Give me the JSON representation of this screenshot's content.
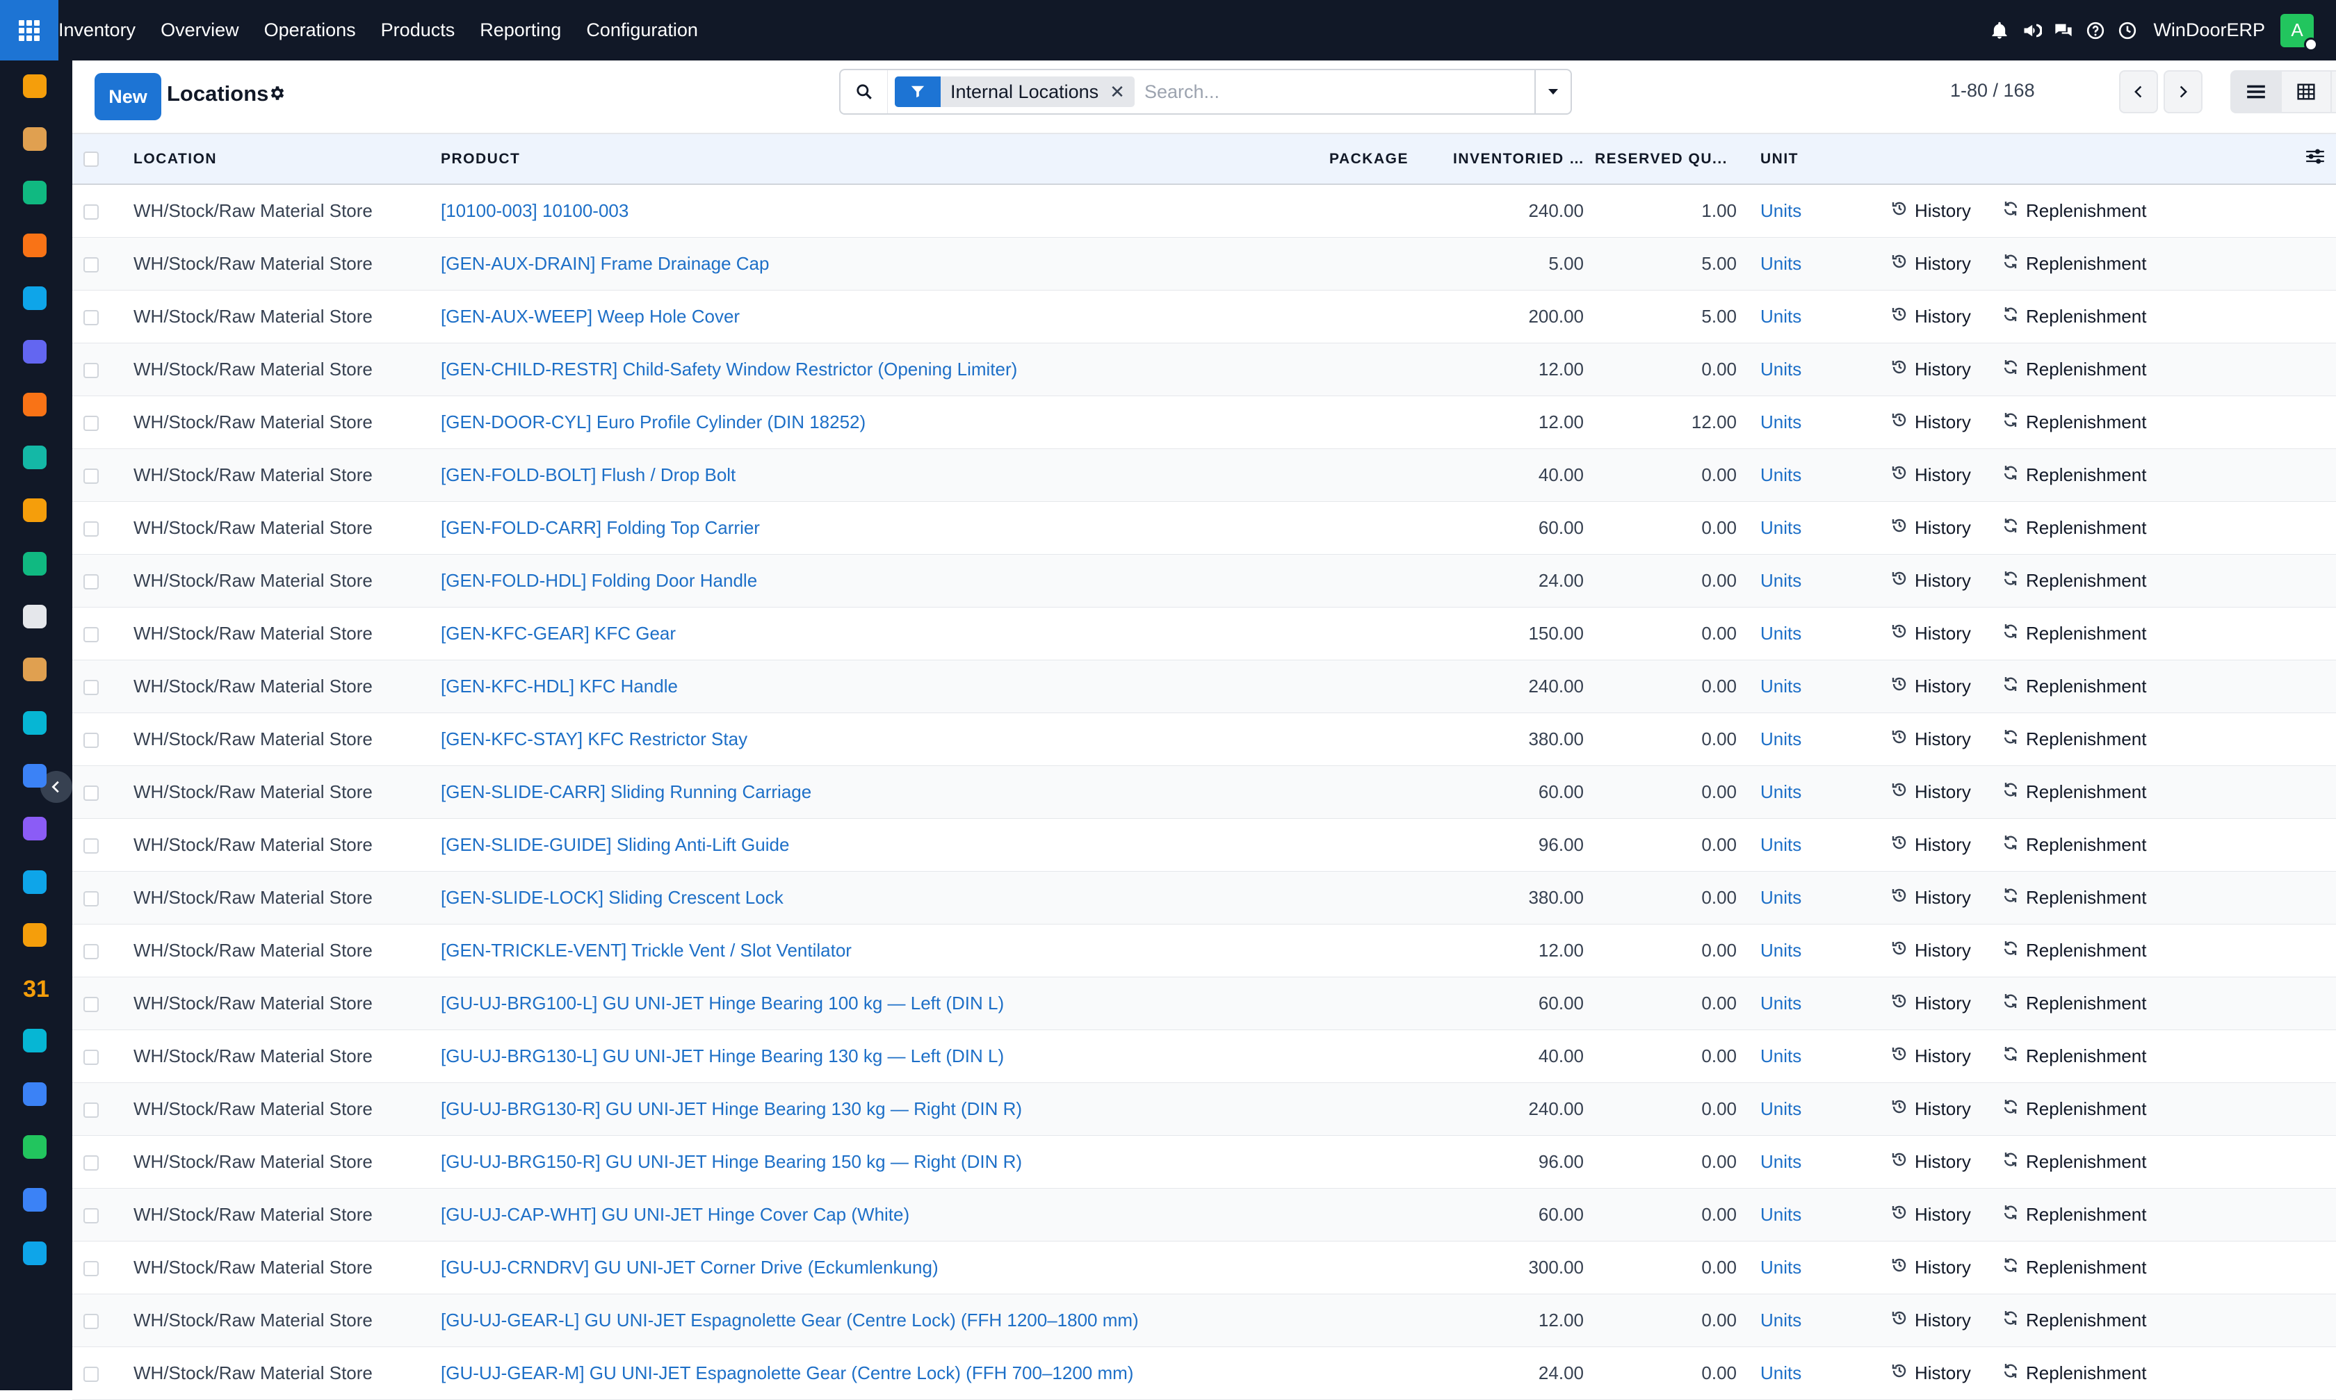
{
  "topbar": {
    "apps_icon": "grid-apps-icon",
    "app_name": "Inventory",
    "menu": [
      "Overview",
      "Operations",
      "Products",
      "Reporting",
      "Configuration"
    ],
    "icons": [
      "bell-icon",
      "megaphone-icon",
      "chat-icon",
      "help-icon",
      "clock-icon"
    ],
    "company": "WinDoorERP",
    "avatar_letter": "A"
  },
  "sidebar": {
    "apps": [
      {
        "name": "bar-chart-app-icon",
        "color": "#f59e0b"
      },
      {
        "name": "gallery-app-icon",
        "color": "#e0a050"
      },
      {
        "name": "contacts-app-icon",
        "color": "#10b981"
      },
      {
        "name": "chat-bubble-app-icon",
        "color": "#f97316"
      },
      {
        "name": "wave-app-icon",
        "color": "#0ea5e9"
      },
      {
        "name": "mail-app-icon",
        "color": "#6366f1"
      },
      {
        "name": "livechat-app-icon",
        "color": "#f97316"
      },
      {
        "name": "sign-app-icon",
        "color": "#14b8a6"
      },
      {
        "name": "reporting-app-icon",
        "color": "#f59e0b"
      },
      {
        "name": "employees-app-icon",
        "color": "#10b981"
      },
      {
        "name": "cube-app-icon",
        "color": "#e5e7eb"
      },
      {
        "name": "studio-app-icon",
        "color": "#e0a050"
      },
      {
        "name": "tasks-app-icon",
        "color": "#06b6d4"
      },
      {
        "name": "knowledge-app-icon",
        "color": "#3b82f6"
      },
      {
        "name": "inventory-app-icon",
        "color": "#8b5cf6"
      },
      {
        "name": "invoicing-app-icon",
        "color": "#0ea5e9"
      },
      {
        "name": "team-app-icon",
        "color": "#f59e0b"
      },
      {
        "name": "calendar-app-icon",
        "color": "#f59e0b",
        "label": "31"
      },
      {
        "name": "pen-app-icon",
        "color": "#06b6d4"
      },
      {
        "name": "dashboard-app-icon",
        "color": "#3b82f6"
      },
      {
        "name": "whatsapp-app-icon",
        "color": "#22c55e"
      },
      {
        "name": "compass-app-icon",
        "color": "#3b82f6"
      },
      {
        "name": "wave2-app-icon",
        "color": "#0ea5e9"
      }
    ]
  },
  "control": {
    "new_label": "New",
    "title": "Locations",
    "facet_label": "Internal Locations",
    "search_placeholder": "Search...",
    "pager": "1-80 / 168"
  },
  "table": {
    "headers": {
      "location": "LOCATION",
      "product": "PRODUCT",
      "package": "PACKAGE",
      "inventoried": "INVENTORIED ...",
      "reserved": "RESERVED QU...",
      "unit": "UNIT"
    },
    "history_label": "History",
    "replenish_label": "Replenishment",
    "rows": [
      {
        "location": "WH/Stock/Raw Material Store",
        "product": "[10100-003] 10100-003",
        "package": "",
        "inventoried": "240.00",
        "reserved": "1.00",
        "unit": "Units"
      },
      {
        "location": "WH/Stock/Raw Material Store",
        "product": "[GEN-AUX-DRAIN] Frame Drainage Cap",
        "package": "",
        "inventoried": "5.00",
        "reserved": "5.00",
        "unit": "Units"
      },
      {
        "location": "WH/Stock/Raw Material Store",
        "product": "[GEN-AUX-WEEP] Weep Hole Cover",
        "package": "",
        "inventoried": "200.00",
        "reserved": "5.00",
        "unit": "Units"
      },
      {
        "location": "WH/Stock/Raw Material Store",
        "product": "[GEN-CHILD-RESTR] Child-Safety Window Restrictor (Opening Limiter)",
        "package": "",
        "inventoried": "12.00",
        "reserved": "0.00",
        "unit": "Units"
      },
      {
        "location": "WH/Stock/Raw Material Store",
        "product": "[GEN-DOOR-CYL] Euro Profile Cylinder (DIN 18252)",
        "package": "",
        "inventoried": "12.00",
        "reserved": "12.00",
        "unit": "Units"
      },
      {
        "location": "WH/Stock/Raw Material Store",
        "product": "[GEN-FOLD-BOLT] Flush / Drop Bolt",
        "package": "",
        "inventoried": "40.00",
        "reserved": "0.00",
        "unit": "Units"
      },
      {
        "location": "WH/Stock/Raw Material Store",
        "product": "[GEN-FOLD-CARR] Folding Top Carrier",
        "package": "",
        "inventoried": "60.00",
        "reserved": "0.00",
        "unit": "Units"
      },
      {
        "location": "WH/Stock/Raw Material Store",
        "product": "[GEN-FOLD-HDL] Folding Door Handle",
        "package": "",
        "inventoried": "24.00",
        "reserved": "0.00",
        "unit": "Units"
      },
      {
        "location": "WH/Stock/Raw Material Store",
        "product": "[GEN-KFC-GEAR] KFC Gear",
        "package": "",
        "inventoried": "150.00",
        "reserved": "0.00",
        "unit": "Units"
      },
      {
        "location": "WH/Stock/Raw Material Store",
        "product": "[GEN-KFC-HDL] KFC Handle",
        "package": "",
        "inventoried": "240.00",
        "reserved": "0.00",
        "unit": "Units"
      },
      {
        "location": "WH/Stock/Raw Material Store",
        "product": "[GEN-KFC-STAY] KFC Restrictor Stay",
        "package": "",
        "inventoried": "380.00",
        "reserved": "0.00",
        "unit": "Units"
      },
      {
        "location": "WH/Stock/Raw Material Store",
        "product": "[GEN-SLIDE-CARR] Sliding Running Carriage",
        "package": "",
        "inventoried": "60.00",
        "reserved": "0.00",
        "unit": "Units"
      },
      {
        "location": "WH/Stock/Raw Material Store",
        "product": "[GEN-SLIDE-GUIDE] Sliding Anti-Lift Guide",
        "package": "",
        "inventoried": "96.00",
        "reserved": "0.00",
        "unit": "Units"
      },
      {
        "location": "WH/Stock/Raw Material Store",
        "product": "[GEN-SLIDE-LOCK] Sliding Crescent Lock",
        "package": "",
        "inventoried": "380.00",
        "reserved": "0.00",
        "unit": "Units"
      },
      {
        "location": "WH/Stock/Raw Material Store",
        "product": "[GEN-TRICKLE-VENT] Trickle Vent / Slot Ventilator",
        "package": "",
        "inventoried": "12.00",
        "reserved": "0.00",
        "unit": "Units"
      },
      {
        "location": "WH/Stock/Raw Material Store",
        "product": "[GU-UJ-BRG100-L] GU UNI-JET Hinge Bearing 100 kg — Left (DIN L)",
        "package": "",
        "inventoried": "60.00",
        "reserved": "0.00",
        "unit": "Units"
      },
      {
        "location": "WH/Stock/Raw Material Store",
        "product": "[GU-UJ-BRG130-L] GU UNI-JET Hinge Bearing 130 kg — Left (DIN L)",
        "package": "",
        "inventoried": "40.00",
        "reserved": "0.00",
        "unit": "Units"
      },
      {
        "location": "WH/Stock/Raw Material Store",
        "product": "[GU-UJ-BRG130-R] GU UNI-JET Hinge Bearing 130 kg — Right (DIN R)",
        "package": "",
        "inventoried": "240.00",
        "reserved": "0.00",
        "unit": "Units"
      },
      {
        "location": "WH/Stock/Raw Material Store",
        "product": "[GU-UJ-BRG150-R] GU UNI-JET Hinge Bearing 150 kg — Right (DIN R)",
        "package": "",
        "inventoried": "96.00",
        "reserved": "0.00",
        "unit": "Units"
      },
      {
        "location": "WH/Stock/Raw Material Store",
        "product": "[GU-UJ-CAP-WHT] GU UNI-JET Hinge Cover Cap (White)",
        "package": "",
        "inventoried": "60.00",
        "reserved": "0.00",
        "unit": "Units"
      },
      {
        "location": "WH/Stock/Raw Material Store",
        "product": "[GU-UJ-CRNDRV] GU UNI-JET Corner Drive (Eckumlenkung)",
        "package": "",
        "inventoried": "300.00",
        "reserved": "0.00",
        "unit": "Units"
      },
      {
        "location": "WH/Stock/Raw Material Store",
        "product": "[GU-UJ-GEAR-L] GU UNI-JET Espagnolette Gear (Centre Lock) (FFH 1200–1800 mm)",
        "package": "",
        "inventoried": "12.00",
        "reserved": "0.00",
        "unit": "Units"
      },
      {
        "location": "WH/Stock/Raw Material Store",
        "product": "[GU-UJ-GEAR-M] GU UNI-JET Espagnolette Gear (Centre Lock) (FFH 700–1200 mm)",
        "package": "",
        "inventoried": "24.00",
        "reserved": "0.00",
        "unit": "Units"
      }
    ]
  }
}
